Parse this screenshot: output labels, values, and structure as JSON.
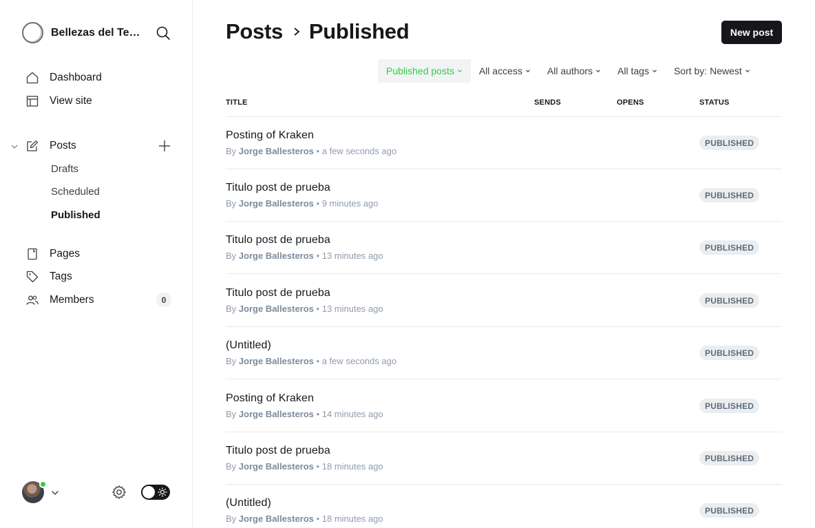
{
  "sidebar": {
    "brand_name": "Bellezas del Test...",
    "nav": {
      "dashboard": "Dashboard",
      "view_site": "View site",
      "posts": "Posts",
      "pages": "Pages",
      "tags": "Tags",
      "members": "Members"
    },
    "posts_sub": {
      "drafts": "Drafts",
      "scheduled": "Scheduled",
      "published": "Published"
    },
    "members_count": "0"
  },
  "header": {
    "title": "Posts",
    "crumb": "Published",
    "new_post_label": "New post"
  },
  "filters": {
    "type": "Published posts",
    "access": "All access",
    "authors": "All authors",
    "tags": "All tags",
    "sort": "Sort by: Newest"
  },
  "table": {
    "columns": {
      "title": "TITLE",
      "sends": "SENDS",
      "opens": "OPENS",
      "status": "STATUS"
    },
    "rows": [
      {
        "title": "Posting of Kraken",
        "by": "By",
        "author": "Jorge Ballesteros",
        "sep": "•",
        "time": "a few seconds ago",
        "status": "PUBLISHED"
      },
      {
        "title": "Titulo post de prueba",
        "by": "By",
        "author": "Jorge Ballesteros",
        "sep": "•",
        "time": "9 minutes ago",
        "status": "PUBLISHED"
      },
      {
        "title": "Titulo post de prueba",
        "by": "By",
        "author": "Jorge Ballesteros",
        "sep": "•",
        "time": "13 minutes ago",
        "status": "PUBLISHED"
      },
      {
        "title": "Titulo post de prueba",
        "by": "By",
        "author": "Jorge Ballesteros",
        "sep": "•",
        "time": "13 minutes ago",
        "status": "PUBLISHED"
      },
      {
        "title": "(Untitled)",
        "by": "By",
        "author": "Jorge Ballesteros",
        "sep": "•",
        "time": "a few seconds ago",
        "status": "PUBLISHED"
      },
      {
        "title": "Posting of Kraken",
        "by": "By",
        "author": "Jorge Ballesteros",
        "sep": "•",
        "time": "14 minutes ago",
        "status": "PUBLISHED"
      },
      {
        "title": "Titulo post de prueba",
        "by": "By",
        "author": "Jorge Ballesteros",
        "sep": "•",
        "time": "18 minutes ago",
        "status": "PUBLISHED"
      },
      {
        "title": "(Untitled)",
        "by": "By",
        "author": "Jorge Ballesteros",
        "sep": "•",
        "time": "18 minutes ago",
        "status": "PUBLISHED"
      }
    ]
  },
  "colors": {
    "accent": "#30cf43",
    "text": "#15171a",
    "muted": "#8e9cac",
    "badge_bg": "#eaeef0"
  },
  "icons": [
    "search-icon",
    "home-icon",
    "layout-icon",
    "edit-icon",
    "plus-icon",
    "page-icon",
    "tag-icon",
    "members-icon",
    "gear-icon",
    "sun-icon",
    "chevron-down-icon",
    "chevron-right-icon"
  ]
}
